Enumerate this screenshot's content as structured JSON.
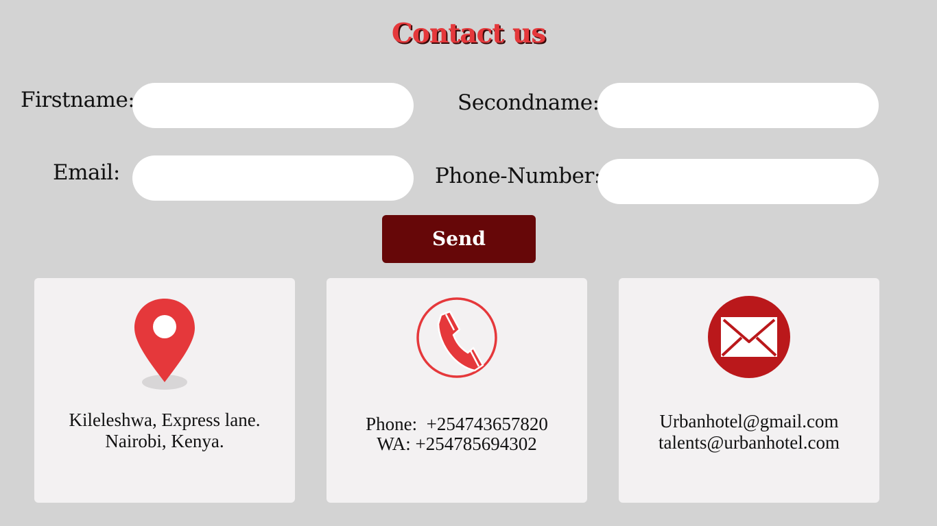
{
  "title": "Contact us",
  "form": {
    "firstname_label": "Firstname:",
    "secondname_label": "Secondname:",
    "email_label": "Email:",
    "phone_label": "Phone-Number:",
    "firstname_value": "",
    "secondname_value": "",
    "email_value": "",
    "phone_value": "",
    "send_label": "Send"
  },
  "cards": {
    "location": {
      "icon": "location-pin-icon",
      "line1": "Kileleshwa, Express lane.",
      "line2": "Nairobi, Kenya."
    },
    "phone": {
      "icon": "phone-icon",
      "line1": "Phone:  +254743657820",
      "line2": "WA: +254785694302"
    },
    "email": {
      "icon": "envelope-icon",
      "line1": "Urbanhotel@gmail.com",
      "line2": "talents@urbanhotel.com"
    }
  },
  "colors": {
    "background": "#d3d3d3",
    "accent_red": "#e5383b",
    "dark_red": "#660708",
    "envelope_red": "#ba181b",
    "card_bg": "#f3f1f2",
    "field_bg": "#ffffff"
  }
}
